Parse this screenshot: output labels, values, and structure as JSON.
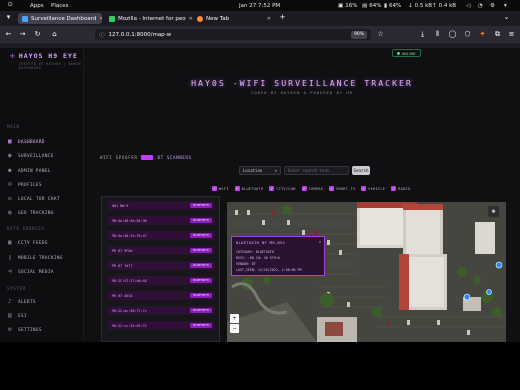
{
  "system_bar": {
    "apps": "Apps",
    "places": "Places",
    "clock": "Jan 27   7:52 PM",
    "cpu": "16%",
    "mem": "64%",
    "battery": "64%",
    "net_down": "0.5 kB",
    "net_up": "0.4 kB"
  },
  "browser": {
    "tabs": [
      {
        "label": "Surveillance Dashboard"
      },
      {
        "label": "Mozilla - Internet for peo"
      },
      {
        "label": "New Tab"
      }
    ],
    "new_tab": "+",
    "url": "127.0.0.1:8000/map-w",
    "zoom": "90%"
  },
  "app": {
    "brand": "HAYOS H9 EYE",
    "brand_sub": "CREATED BY HAYDEN | ADMIN DASHBOARD",
    "status": "ONLINE",
    "sections": {
      "main": "MAIN",
      "data": "DATA SOURCES",
      "system": "SYSTEM"
    },
    "nav_main": [
      "DASHBOARD",
      "SURVEILLANCE",
      "ADMIN PANEL",
      "PROFILES",
      "LOCAL TOR CHAT",
      "GEO TRACKING"
    ],
    "nav_data": [
      "CCTV FEEDS",
      "MOBILE TRACKING",
      "SOCIAL MEDIA"
    ],
    "nav_system": [
      "ALERTS",
      "ESI",
      "SETTINGS"
    ]
  },
  "page": {
    "title": "HAY0S -WIFI SURVEILLANCE TRACKER",
    "subtitle": "CODED BY HAYDEN & POWERED BY H9",
    "toggle_left": "WIFI SPOOFER",
    "toggle_right": "BT SCANNERS",
    "select_value": "Location",
    "search_placeholder": "Enter search term",
    "search_button": "Search",
    "filters": [
      "WIFI",
      "BLUETOOTH",
      "CCTV/CAM",
      "CAMERA",
      "SMART_TV",
      "VEHICLE",
      "RADIO"
    ]
  },
  "list": {
    "tag": "BLUETOOTH",
    "rows": [
      "001 NW-9",
      "98:5a:46:9a:84:36",
      "98:5a:46:7e:76:47",
      "PR 07 9F6d",
      "PR 07 7d77",
      "98:2C:57:17:a6:48",
      "PR 07 A6C8",
      "98:22:ac:50:77:7c",
      "98:22:cc:33:03:72"
    ]
  },
  "map": {
    "popup_title": "BLUETOOTH NF M9-B52",
    "popup_lines": [
      "CATEGORY: BLUETOOTH",
      "RSSI: -68 CH: 40 STR:W",
      "VENDOR: BT",
      "LAST_SEEN: 12/16/2022, 2:58:00 PM"
    ],
    "zoom_in": "+",
    "zoom_out": "−"
  }
}
